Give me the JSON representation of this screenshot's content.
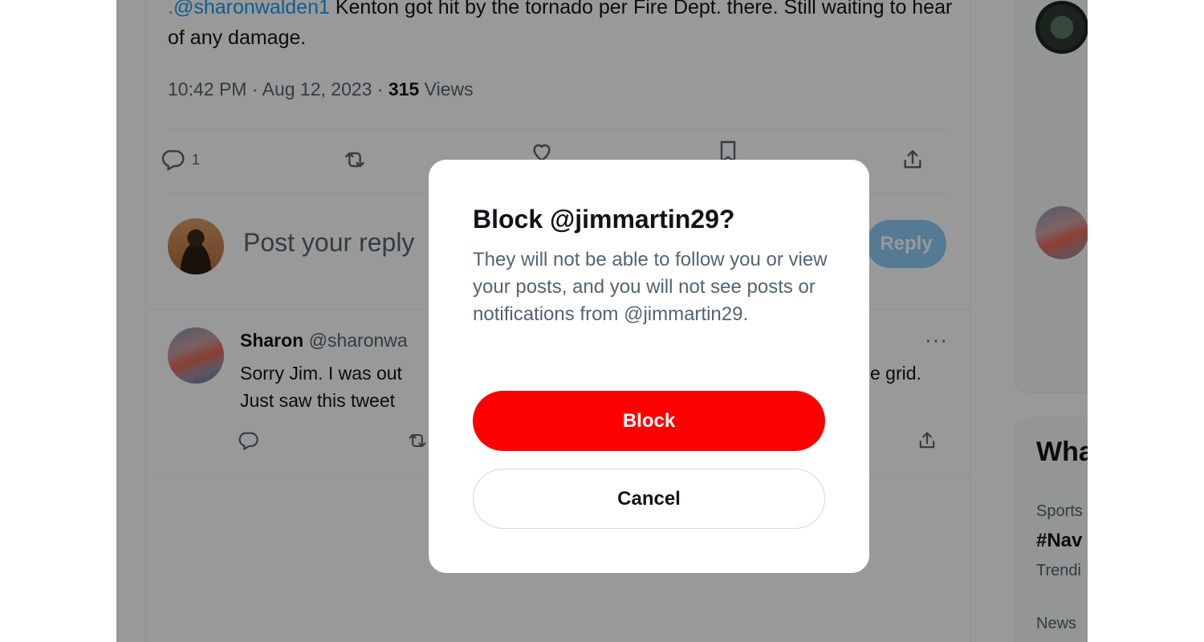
{
  "tweet": {
    "mention": ".@sharonwalden1",
    "text": " Kenton got hit by the tornado per Fire Dept. there. Still waiting to hear of any damage.",
    "time": "10:42 PM · Aug 12, 2023 · ",
    "views_count": "315",
    "views_label": " Views",
    "reply_count": "1"
  },
  "composer": {
    "placeholder": "Post your reply",
    "reply_button": "Reply"
  },
  "reply": {
    "name": "Sharon",
    "handle": " @sharonwa",
    "text_line1": "Sorry Jim. I was out ",
    "text_line1_end": "e grid.",
    "text_line2": "Just saw this tweet",
    "more": "···"
  },
  "sidebar": {
    "trends_title": "Wha",
    "trend1_category": "Sports",
    "trend1_tag": "#Nav",
    "trend1_meta": "Trendi",
    "trend2_category": "News"
  },
  "modal": {
    "title": "Block @jimmartin29?",
    "body": "They will not be able to follow you or view your posts, and you will not see posts or notifications from @jimmartin29.",
    "block_button": "Block",
    "cancel_button": "Cancel"
  },
  "icons": {
    "reply": "reply-icon",
    "repost": "repost-icon",
    "like": "like-icon",
    "bookmark": "bookmark-icon",
    "share": "share-icon",
    "more": "more-icon"
  },
  "colors": {
    "accent": "#1d9bf0",
    "danger": "#fd0000",
    "text_primary": "#0f1419",
    "text_secondary": "#536471"
  }
}
